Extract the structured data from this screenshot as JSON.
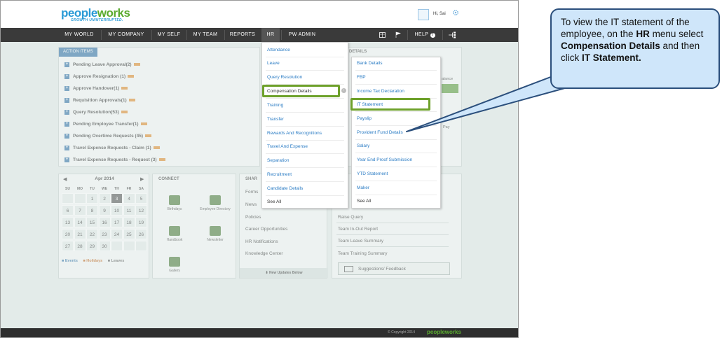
{
  "header": {
    "logo_left": "people",
    "logo_right": "works",
    "tagline": "GROWTH UNINTERRUPTED.",
    "user_greeting": "Hi, Sai"
  },
  "nav": {
    "items": [
      "MY WORLD",
      "MY COMPANY",
      "MY SELF",
      "MY TEAM",
      "REPORTS",
      "HR",
      "PW ADMIN"
    ],
    "help": "HELP"
  },
  "action_items": {
    "title": "ACTION ITEMS",
    "rows": [
      "Pending Leave Approval(2)",
      "Approve Resignation (1)",
      "Approve Handover(1)",
      "Requisition Approvals(1)",
      "Query Resolution(53)",
      "Pending Employee Transfer(1)",
      "Pending Overtime Requests (45)",
      "Travel Expense Requests - Claim (1)",
      "Travel Expense Requests - Request (3)"
    ]
  },
  "details_title": "DETAILS",
  "details_fragments": [
    "alance",
    "Pay"
  ],
  "calendar": {
    "month": "Apr 2014",
    "days_of_week": [
      "SU",
      "MO",
      "TU",
      "WE",
      "TH",
      "FR",
      "SA"
    ],
    "weeks": [
      [
        "",
        "",
        "1",
        "2",
        "3",
        "4",
        "5"
      ],
      [
        "6",
        "7",
        "8",
        "9",
        "10",
        "11",
        "12"
      ],
      [
        "13",
        "14",
        "15",
        "16",
        "17",
        "18",
        "19"
      ],
      [
        "20",
        "21",
        "22",
        "23",
        "24",
        "25",
        "26"
      ],
      [
        "27",
        "28",
        "29",
        "30",
        "",
        "",
        ""
      ]
    ],
    "today": "3",
    "legend": [
      "Events",
      "Holidays",
      "Leaves"
    ]
  },
  "connect": {
    "title": "CONNECT",
    "tiles": [
      "Birthdays",
      "Employee Directory",
      "Handbook",
      "Newsletter",
      "Gallery"
    ]
  },
  "share": {
    "title": "SHAR",
    "rows": [
      "Forms",
      "News",
      "Policies",
      "Career Opportunities",
      "HR Notifications",
      "Knowledge Center"
    ],
    "footer": "New Updates Below"
  },
  "right_list": {
    "rows": [
      "Raise Query",
      "Team In-Out Report",
      "Team Leave Summary",
      "Team Training Summary"
    ],
    "feedback": "Suggestions/ Feedback"
  },
  "footer": {
    "copyright": "© Copyright 2014",
    "logo": "peopleworks"
  },
  "hr_menu": {
    "left": [
      "Attendance",
      "Leave",
      "Query Resolution",
      "Compensation Details",
      "Training",
      "Transfer",
      "Rewards And Recognitions",
      "Travel And Expense",
      "Separation",
      "Recruitment",
      "Candidate Details",
      "See All"
    ],
    "right": [
      "Bank Details",
      "FBP",
      "Income Tax Declaration",
      "IT Statement",
      "Payslip",
      "Provident Fund Details",
      "Salary",
      "Year End Proof Submission",
      "YTD Statement",
      "Maker",
      "See All"
    ]
  },
  "callout": {
    "t1": "To view the IT  statement of the employee, on the ",
    "b1": "HR",
    "t2": " menu select ",
    "b2": "Compensation Details",
    "t3": " and then click ",
    "b3": "IT Statement."
  },
  "colors": {
    "nav_bg": "#3a3a3a",
    "link_blue": "#2b7cc4",
    "highlight_green": "#6ea12b",
    "callout_bg": "#cfe6fa",
    "callout_border": "#2b4f7c"
  }
}
